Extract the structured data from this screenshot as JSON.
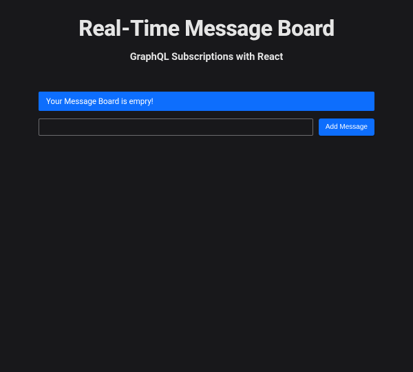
{
  "header": {
    "title": "Real-Time Message Board",
    "subtitle": "GraphQL Subscriptions with React"
  },
  "board": {
    "empty_message": "Your Message Board is empry!",
    "input_value": "",
    "add_button_label": "Add Message"
  }
}
